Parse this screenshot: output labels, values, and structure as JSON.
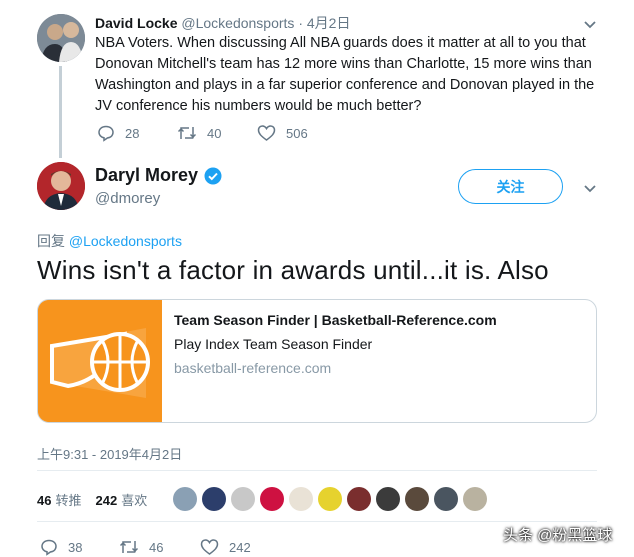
{
  "reply_tweet": {
    "name": "David Locke",
    "handle": "@Lockedonsports",
    "dot": "·",
    "date": "4月2日",
    "text": "NBA Voters.  When discussing All NBA guards does it matter at all to you that Donovan Mitchell's team has 12 more wins than Charlotte, 15 more wins than Washington and plays in a far superior conference and Donovan played in the JV conference his numbers would be much better?",
    "replies": "28",
    "retweets": "40",
    "likes": "506"
  },
  "main_tweet": {
    "name": "Daryl Morey",
    "handle": "@dmorey",
    "follow_label": "关注",
    "reply_prefix": "回复",
    "reply_mention": "@Lockedonsports",
    "text": "Wins isn't a factor in awards until...it is. Also",
    "card": {
      "title": "Team Season Finder | Basketball-Reference.com",
      "description": "Play Index Team Season Finder",
      "domain": "basketball-reference.com"
    },
    "timestamp": "上午9:31 - 2019年4月2日",
    "stats": {
      "retweets_count": "46",
      "retweets_label": "转推",
      "likes_count": "242",
      "likes_label": "喜欢"
    },
    "actions": {
      "replies": "38",
      "retweets": "46",
      "likes": "242"
    }
  },
  "watermark": "头条 @粉黑篮球",
  "colors": {
    "accent": "#1da1f2",
    "card_image": "#f7941d",
    "muted": "#657786"
  }
}
